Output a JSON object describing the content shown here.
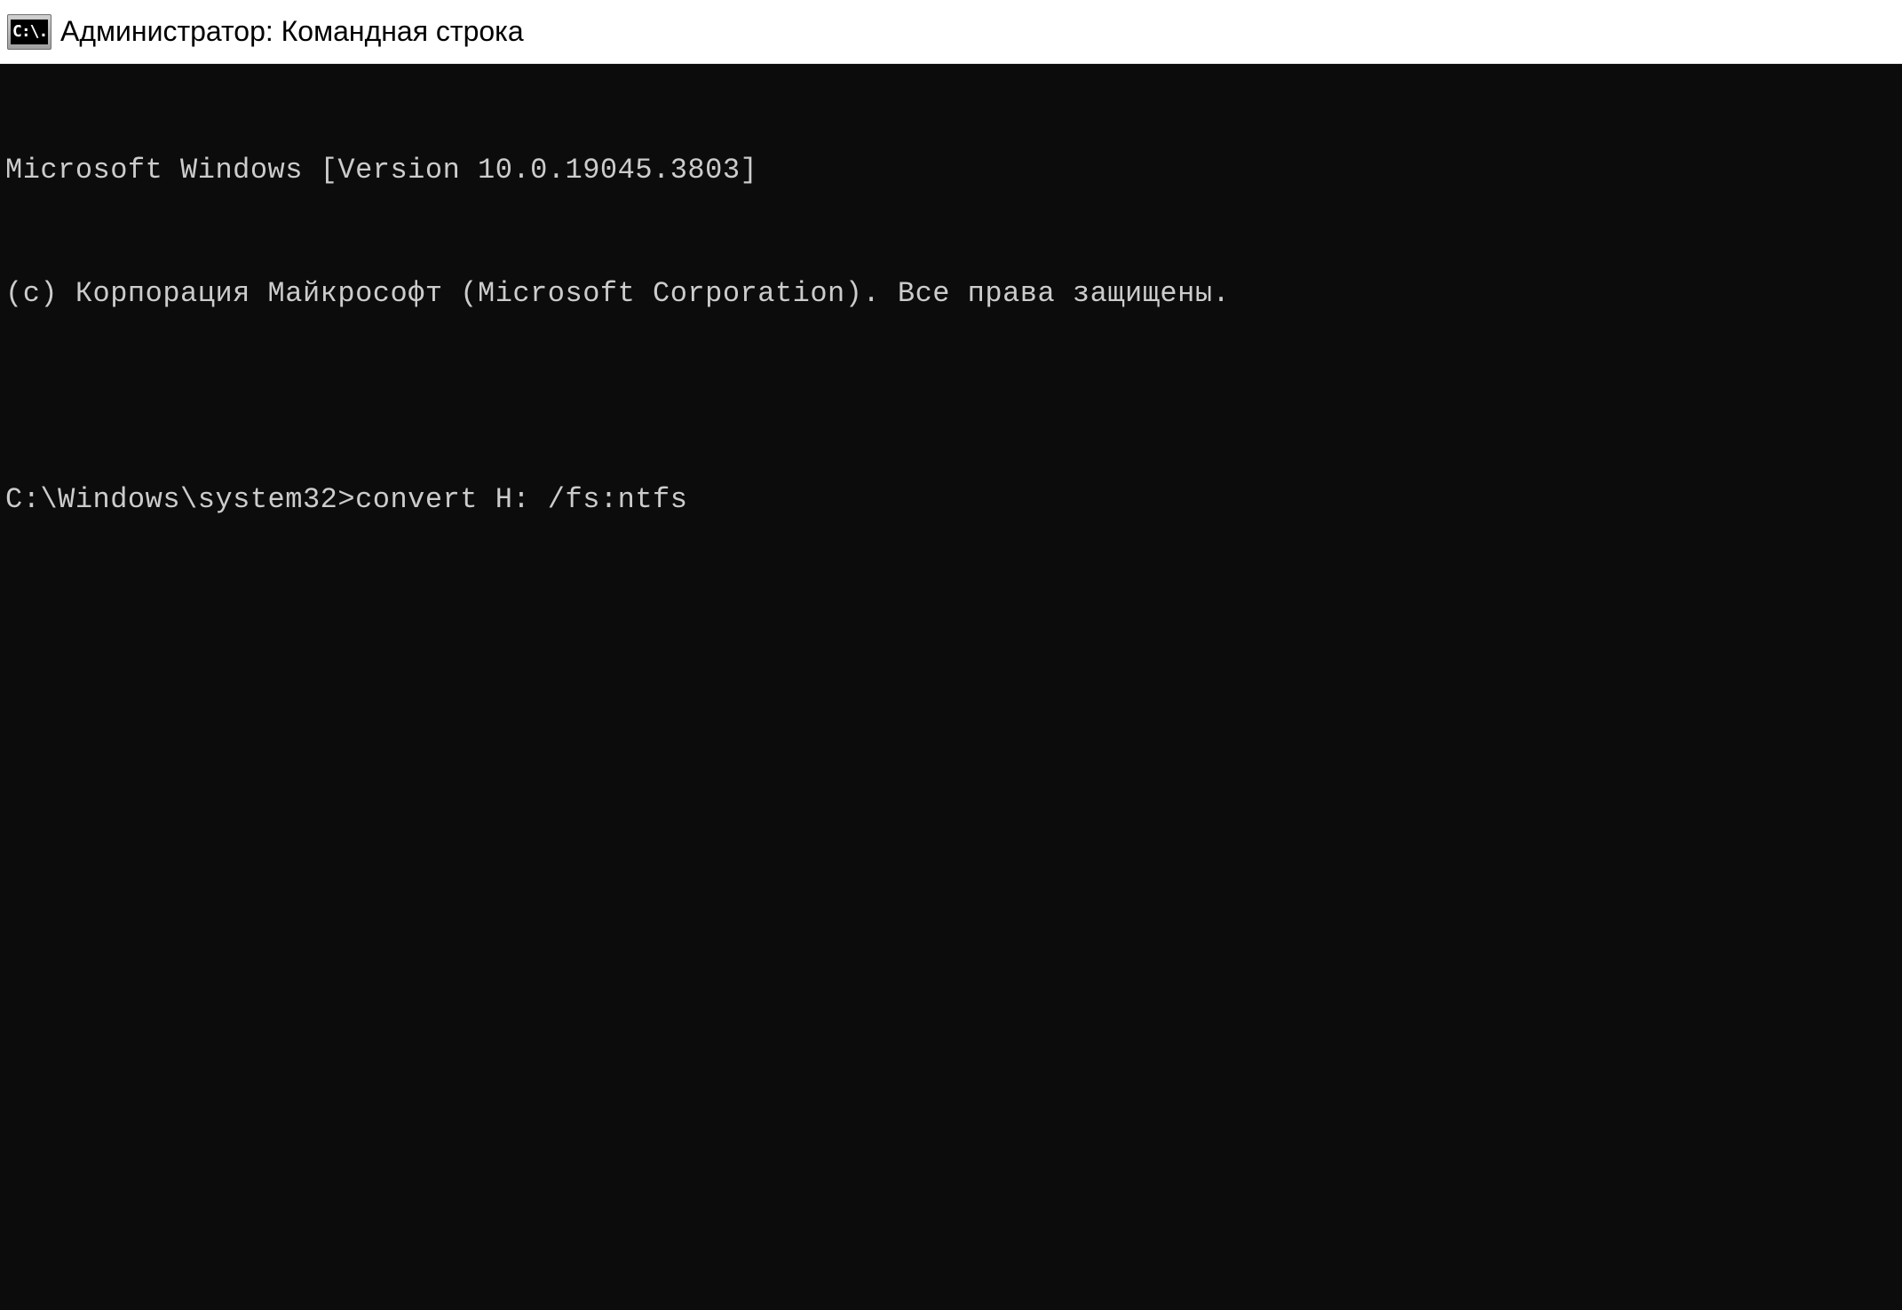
{
  "titlebar": {
    "icon_text": "C:\\.",
    "title": "Администратор: Командная строка"
  },
  "terminal": {
    "line1": "Microsoft Windows [Version 10.0.19045.3803]",
    "line2": "(c) Корпорация Майкрософт (Microsoft Corporation). Все права защищены.",
    "blank": "",
    "prompt": "C:\\Windows\\system32>",
    "command": "convert H: /fs:ntfs"
  }
}
